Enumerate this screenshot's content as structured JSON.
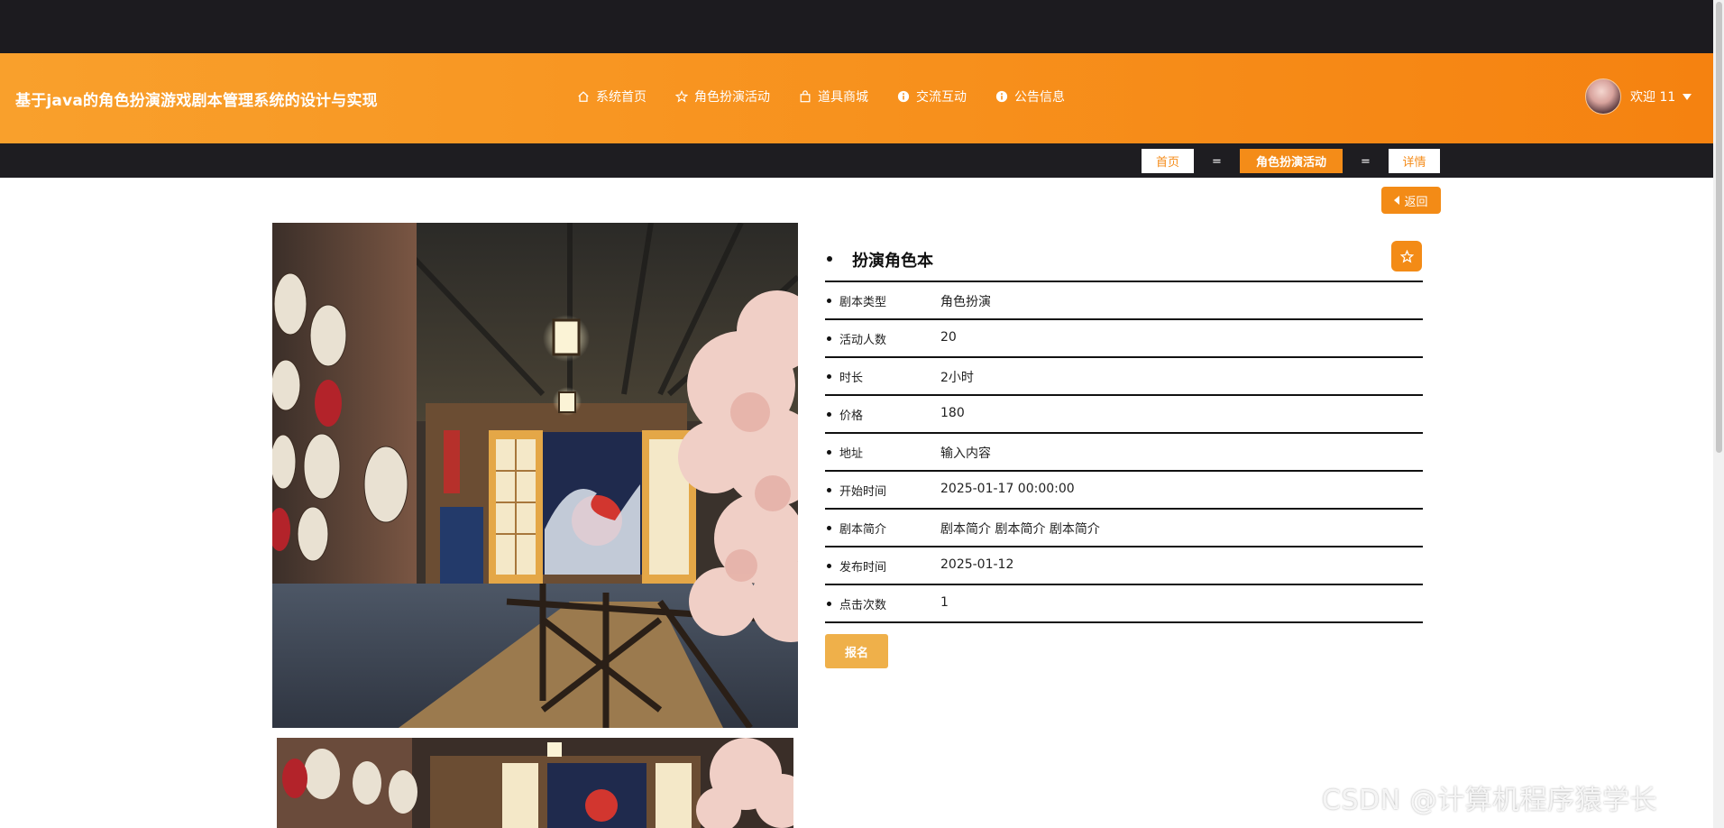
{
  "site": {
    "title": "基于java的角色扮演游戏剧本管理系统的设计与实现"
  },
  "nav": {
    "items": [
      {
        "label": "系统首页",
        "icon": "home-icon"
      },
      {
        "label": "角色扮演活动",
        "icon": "star-icon"
      },
      {
        "label": "道具商城",
        "icon": "bag-icon"
      },
      {
        "label": "交流互动",
        "icon": "info-icon"
      },
      {
        "label": "公告信息",
        "icon": "info-icon"
      }
    ]
  },
  "user": {
    "welcome": "欢迎 11"
  },
  "breadcrumb": {
    "home": "首页",
    "section": "角色扮演活动",
    "current": "详情",
    "separator": "="
  },
  "back_label": "返回",
  "detail": {
    "title": "扮演角色本",
    "rows": [
      {
        "label": "剧本类型",
        "value": "角色扮演"
      },
      {
        "label": "活动人数",
        "value": "20"
      },
      {
        "label": "时长",
        "value": "2小时"
      },
      {
        "label": "价格",
        "value": "180"
      },
      {
        "label": "地址",
        "value": "输入内容"
      },
      {
        "label": "开始时间",
        "value": "2025-01-17 00:00:00"
      },
      {
        "label": "剧本简介",
        "value": "剧本简介 剧本简介 剧本简介"
      },
      {
        "label": "发布时间",
        "value": "2025-01-12"
      },
      {
        "label": "点击次数",
        "value": "1"
      }
    ],
    "signup_label": "报名"
  },
  "watermark": "CSDN @计算机程序猿学长",
  "colors": {
    "accent": "#f38b16",
    "header_dark": "#1c1b1f",
    "signup": "#efb04a"
  }
}
